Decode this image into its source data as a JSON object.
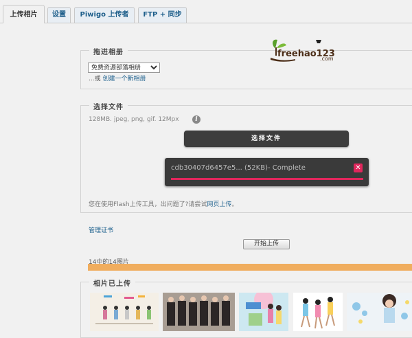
{
  "tabs": [
    {
      "label": "上传相片",
      "active": true
    },
    {
      "label": "设置",
      "active": false
    },
    {
      "label": "Piwigo 上传者",
      "active": false
    },
    {
      "label": "FTP + 同步",
      "active": false
    }
  ],
  "logo": {
    "brand": "freehao123.com",
    "text_main": "freehao123",
    "text_sub": ".com",
    "colors": {
      "leaf": "#5aa02c",
      "text": "#4b2d17",
      "hat": "#222222"
    }
  },
  "album": {
    "legend": "拖进相册",
    "selected": "免费资源部落相册",
    "or_text": "...或",
    "create_link": "创建一个新相册"
  },
  "select_files": {
    "legend": "选择文件",
    "hint": "128MB. jpeg, png, gif. 12Mpx",
    "info_icon": "info-icon",
    "button_label": "选择文件",
    "queue": {
      "item_text": "cdb30407d6457e5... (52KB)- Complete",
      "progress": 1.0
    },
    "flash_note_prefix": "您在使用Flash上传工具，出问题了?请尝试",
    "flash_note_link": "网页上传",
    "flash_note_suffix": "。"
  },
  "manage_link": "管理证书",
  "start_button": "开始上传",
  "upload_progress": {
    "text": "14中的14图片",
    "fraction": 1.0
  },
  "uploaded": {
    "legend": "相片已上传",
    "thumb_count": 6
  },
  "colors": {
    "accent": "#e1265c",
    "progress": "#f0ad5e",
    "link": "#1a5e8c"
  }
}
